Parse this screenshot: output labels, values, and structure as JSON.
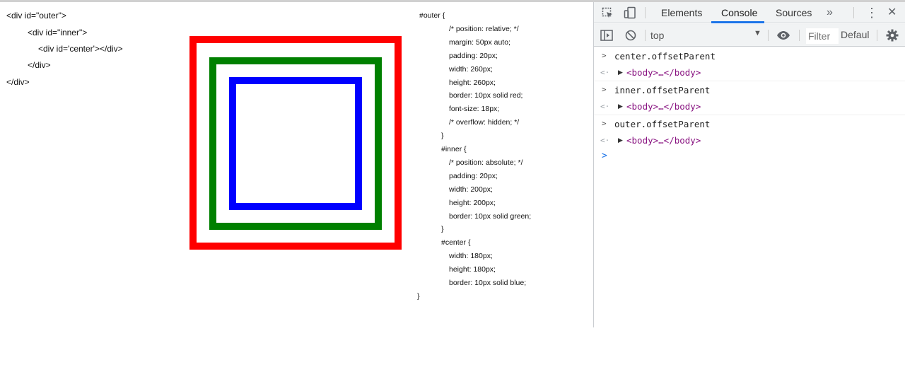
{
  "html_source": [
    "<div id=\"outer\">",
    "<div id=\"inner\">",
    "<div id='center'></div>",
    "</div>",
    "</div>"
  ],
  "css_source": [
    "#outer {",
    "/* position: relative; */",
    "margin: 50px auto;",
    "padding: 20px;",
    "width: 260px;",
    "height: 260px;",
    "border: 10px solid red;",
    "font-size: 18px;",
    "/* overflow: hidden; */",
    "}",
    "#inner {",
    "/* position: absolute; */",
    "padding: 20px;",
    "width: 200px;",
    "height: 200px;",
    "border: 10px solid green;",
    "}",
    "#center {",
    "width: 180px;",
    "height: 180px;",
    "border: 10px solid blue;",
    "}"
  ],
  "colors": {
    "outer_border": "#ff0000",
    "inner_border": "#008000",
    "center_border": "#0000ff",
    "active_tab_underline": "#1a73e8",
    "node_tag": "#881280"
  },
  "devtools": {
    "tabs": [
      "Elements",
      "Console",
      "Sources"
    ],
    "active_tab": "Console",
    "more_tabs_glyph": "»",
    "kebab_glyph": "⋮",
    "close_glyph": "✕",
    "context": "top",
    "filter_placeholder": "Filter",
    "level": "Defaul",
    "icons": [
      "inspect-icon",
      "device-toolbar-icon",
      "sidebar-toggle-icon",
      "clear-console-icon",
      "eye-icon",
      "gear-icon"
    ]
  },
  "console": {
    "entries": [
      {
        "input": "center.offsetParent",
        "output": "<body>…</body>"
      },
      {
        "input": "inner.offsetParent",
        "output": "<body>…</body>"
      },
      {
        "input": "outer.offsetParent",
        "output": "<body>…</body>"
      }
    ],
    "prompt_glyph": ">",
    "return_glyph": "<·",
    "expand_glyph": "▶",
    "input_caret": ">"
  }
}
